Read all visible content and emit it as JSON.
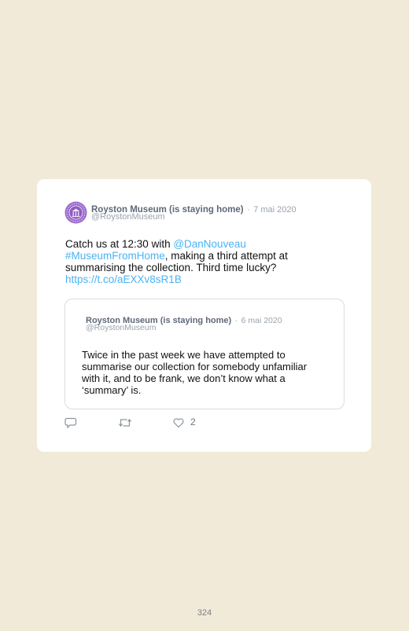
{
  "tweet": {
    "author_name": "Royston Museum (is staying home)",
    "separator": "·",
    "date": "7 mai 2020",
    "handle": "@RoystonMuseum",
    "text_1": "Catch us at 12:30 with ",
    "mention": "@DanNouveau",
    "hashtag": "#MuseumFromHome",
    "text_2": ", making a third attempt at summarising the collection. Third time lucky?",
    "url": "https://t.co/aEXXv8sR1B",
    "like_count": "2"
  },
  "quoted": {
    "author_name": "Royston Museum (is staying home)",
    "separator": "·",
    "date": "6 mai 2020",
    "handle": "@RoystonMuseum",
    "text": "Twice in the past week we have attempted to summarise our collection for somebody unfamiliar with it, and to be frank, we don’t know what a ‘summary’ is."
  },
  "icons": {
    "avatar": "museum-logo-icon",
    "reply": "reply-icon",
    "retweet": "retweet-icon",
    "like": "heart-icon"
  },
  "colors": {
    "page_background": "#f1ead8",
    "link": "#4ab3f4",
    "avatar_purple": "#8e5cc0"
  },
  "page_number": "324"
}
